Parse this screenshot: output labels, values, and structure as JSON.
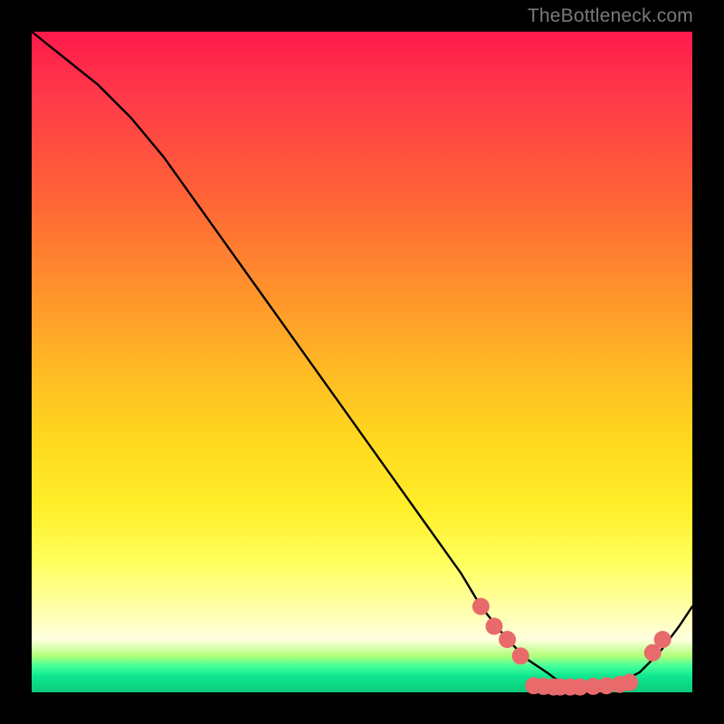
{
  "watermark": "TheBottleneck.com",
  "chart_data": {
    "type": "line",
    "title": "",
    "xlabel": "",
    "ylabel": "",
    "xlim": [
      0,
      100
    ],
    "ylim": [
      0,
      100
    ],
    "curve": {
      "name": "bottleneck-curve",
      "x": [
        0,
        5,
        10,
        15,
        20,
        25,
        30,
        35,
        40,
        45,
        50,
        55,
        60,
        65,
        68,
        72,
        75,
        78,
        80,
        82,
        85,
        88,
        90,
        92,
        95,
        98,
        100
      ],
      "y": [
        100,
        96,
        92,
        87,
        81,
        74,
        67,
        60,
        53,
        46,
        39,
        32,
        25,
        18,
        13,
        8,
        5,
        3,
        1.5,
        1,
        1,
        1.2,
        2,
        3,
        6,
        10,
        13
      ]
    },
    "markers": {
      "name": "highlight-dots",
      "color": "#e86a6a",
      "radius": 9.5,
      "points": [
        {
          "x": 68,
          "y": 13
        },
        {
          "x": 70,
          "y": 10
        },
        {
          "x": 72,
          "y": 8
        },
        {
          "x": 74,
          "y": 5.5
        },
        {
          "x": 76,
          "y": 1
        },
        {
          "x": 77.5,
          "y": 0.9
        },
        {
          "x": 79,
          "y": 0.8
        },
        {
          "x": 80,
          "y": 0.8
        },
        {
          "x": 81.5,
          "y": 0.8
        },
        {
          "x": 83,
          "y": 0.8
        },
        {
          "x": 85,
          "y": 0.9
        },
        {
          "x": 87,
          "y": 1
        },
        {
          "x": 89,
          "y": 1.2
        },
        {
          "x": 90.5,
          "y": 1.5
        },
        {
          "x": 94,
          "y": 6
        },
        {
          "x": 95.5,
          "y": 8
        }
      ]
    }
  }
}
